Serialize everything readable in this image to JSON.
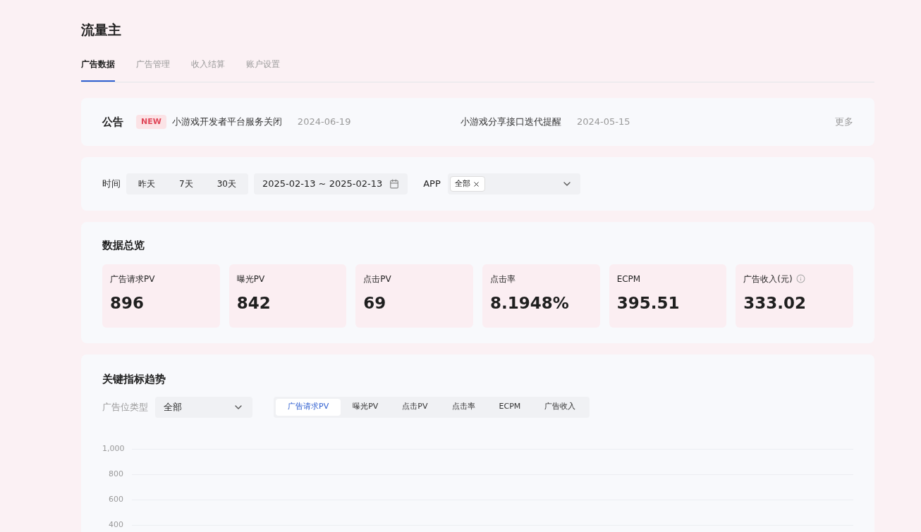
{
  "page_title": "流量主",
  "tabs": [
    {
      "label": "广告数据",
      "selected": true
    },
    {
      "label": "广告管理",
      "selected": false
    },
    {
      "label": "收入结算",
      "selected": false
    },
    {
      "label": "账户设置",
      "selected": false
    }
  ],
  "announcements": {
    "title": "公告",
    "more": "更多",
    "items": [
      {
        "badge": "NEW",
        "text": "小游戏开发者平台服务关闭",
        "date": "2024-06-19"
      },
      {
        "text": "小游戏分享接口迭代提醒",
        "date": "2024-05-15"
      }
    ]
  },
  "filters": {
    "time_label": "时间",
    "quick_ranges": [
      "昨天",
      "7天",
      "30天"
    ],
    "date_range": "2025-02-13 ~ 2025-02-13",
    "app_label": "APP",
    "app_tags": [
      "全部"
    ]
  },
  "overview": {
    "title": "数据总览",
    "metrics": [
      {
        "label": "广告请求PV",
        "value": "896"
      },
      {
        "label": "曝光PV",
        "value": "842"
      },
      {
        "label": "点击PV",
        "value": "69"
      },
      {
        "label": "点击率",
        "value": "8.1948%"
      },
      {
        "label": "ECPM",
        "value": "395.51"
      },
      {
        "label": "广告收入(元)",
        "value": "333.02",
        "info": true
      }
    ]
  },
  "trend": {
    "title": "关键指标趋势",
    "slot_type_label": "广告位类型",
    "slot_type_value": "全部",
    "metric_tabs": [
      {
        "label": "广告请求PV",
        "selected": true
      },
      {
        "label": "曝光PV",
        "selected": false
      },
      {
        "label": "点击PV",
        "selected": false
      },
      {
        "label": "点击率",
        "selected": false
      },
      {
        "label": "ECPM",
        "selected": false
      },
      {
        "label": "广告收入",
        "selected": false
      }
    ],
    "y_axis_labels": [
      "1,000",
      "800",
      "600",
      "400"
    ]
  }
}
